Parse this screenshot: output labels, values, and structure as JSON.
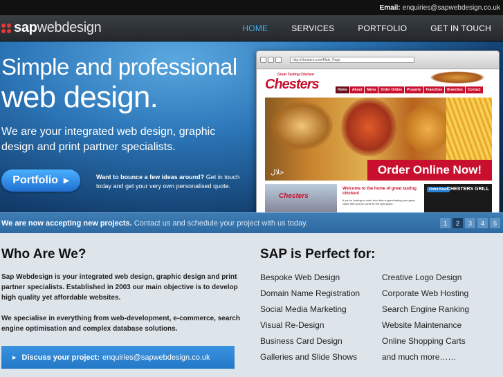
{
  "topbar": {
    "email_label": "Email:",
    "email": "enquiries@sapwebdesign.co.uk"
  },
  "logo": {
    "sap": "sap",
    "webdesign": "webdesign"
  },
  "nav": {
    "items": [
      "HOME",
      "SERVICES",
      "PORTFOLIO",
      "GET IN TOUCH"
    ],
    "active": "HOME"
  },
  "hero": {
    "line1": "Simple and professional",
    "line2": "web design.",
    "subtitle": "We are your integrated web design, graphic design and print partner specialists.",
    "button": "Portfolio",
    "bounce_bold": "Want to bounce a few ideas around?",
    "bounce_rest": " Get in touch today and get your very own personalised quote."
  },
  "screenshot": {
    "url": "http://chesters.com/Main_Page",
    "logo": "Chesters",
    "tagline": "Great Tasting Chicken",
    "menu": [
      "Home",
      "About",
      "Menu",
      "Order Online",
      "Property",
      "Franchise",
      "Branches",
      "Contact"
    ],
    "order_now": "Order Online Now!",
    "arabic": "حلال",
    "welcome": "Welcome to the home of great tasting chicken!",
    "welcome_small": "If you're looking to order food that is great tasting and great value then you've come to the right place.",
    "order_now_badge": "Order Now!",
    "grill": "CHESTERS GRILL",
    "mini_logo": "Chesters"
  },
  "promo": {
    "bold": "We are now accepting new projects.",
    "rest": " Contact us and schedule your project with us today.",
    "pages": [
      "1",
      "2",
      "3",
      "4",
      "5"
    ],
    "active_page": "2"
  },
  "who": {
    "title": "Who Are We?",
    "p1": "Sap Webdesign is your integrated web design, graphic design and print partner specialists. Established in 2003 our main objective is to develop high quality yet affordable websites.",
    "p2": "We specialise in everything from web-development, e-commerce, search engine optimisation and complex database solutions.",
    "discuss_label": "Discuss your project:",
    "discuss_email": "enquiries@sapwebdesign.co.uk"
  },
  "sap": {
    "title": "SAP is Perfect for:",
    "col1": [
      "Bespoke Web Design",
      "Domain Name Registration",
      "Social Media Marketing",
      "Visual Re-Design",
      "Business Card Design",
      "Galleries and Slide Shows"
    ],
    "col2": [
      "Creative Logo Design",
      "Corporate Web Hosting",
      "Search Engine Ranking",
      "Website Maintenance",
      "Online Shopping Carts",
      "and much more……"
    ]
  }
}
